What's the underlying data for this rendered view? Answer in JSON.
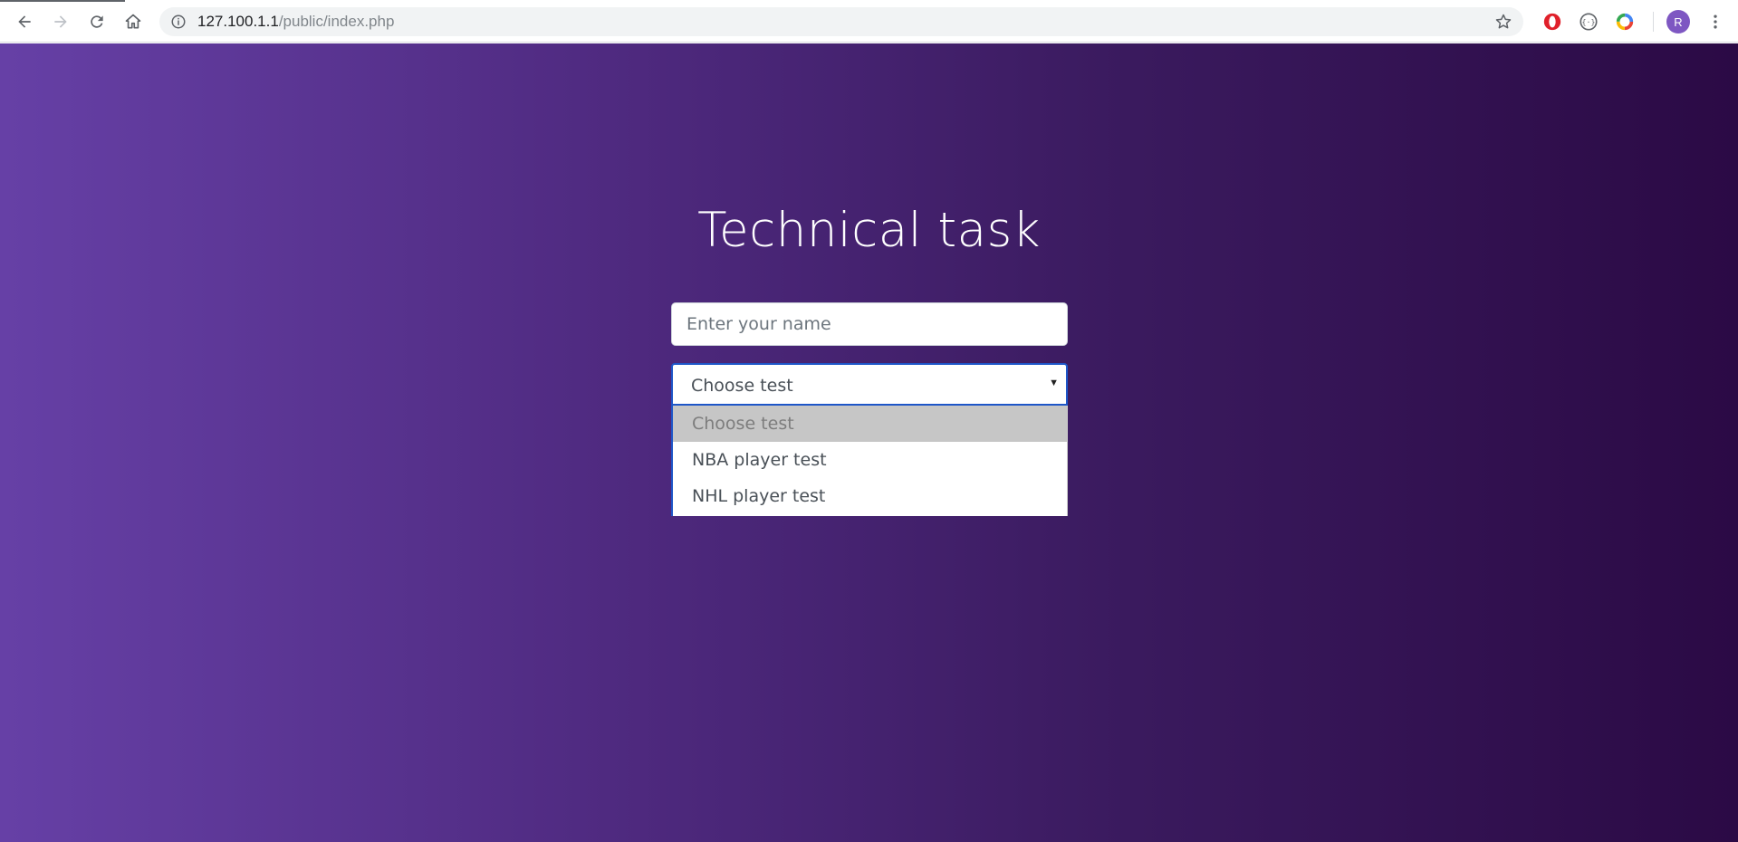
{
  "browser": {
    "url_host": "127.100.1.1",
    "url_path": "/public/index.php",
    "profile_initial": "R",
    "icons": {
      "back": "arrow-left-icon",
      "forward": "arrow-right-icon",
      "reload": "reload-icon",
      "home": "home-icon",
      "info": "info-icon",
      "bookmark": "star-icon",
      "menu": "more-vert-icon"
    }
  },
  "page": {
    "title": "Technical task",
    "name_input": {
      "placeholder": "Enter your name",
      "value": ""
    },
    "test_select": {
      "selected": "Choose test",
      "options": [
        "Choose test",
        "NBA player test",
        "NHL player test"
      ]
    }
  },
  "colors": {
    "gradient_start": "#6640a6",
    "gradient_end": "#2b0a45",
    "focus_border": "#1e56c8"
  }
}
